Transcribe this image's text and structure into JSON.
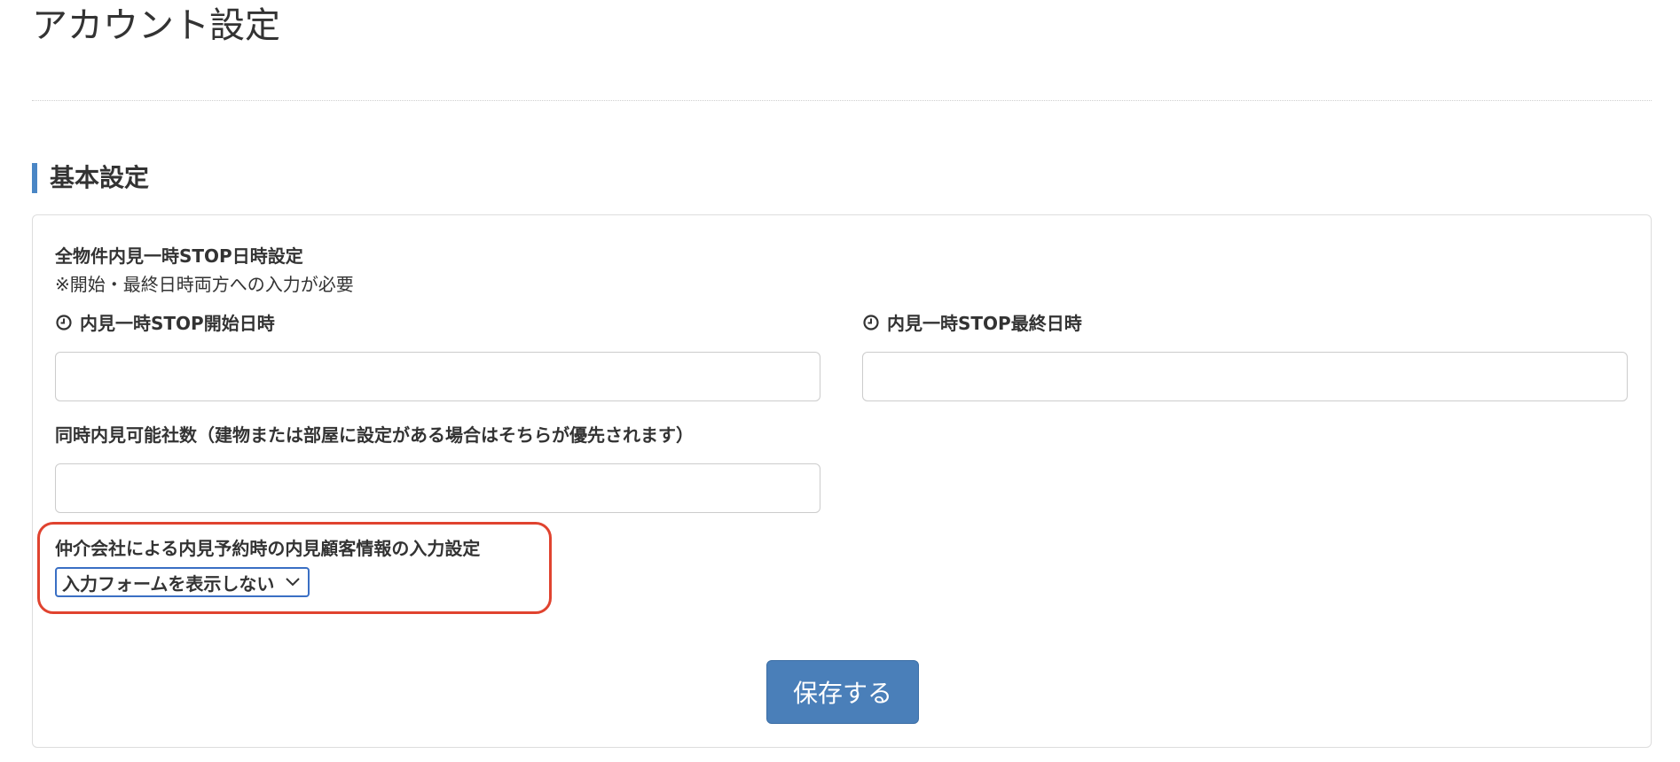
{
  "page": {
    "title": "アカウント設定"
  },
  "section": {
    "heading": "基本設定"
  },
  "form": {
    "stop_title": "全物件内見一時STOP日時設定",
    "stop_note": "※開始・最終日時両方への入力が必要",
    "start_label": "内見一時STOP開始日時",
    "start_value": "",
    "end_label": "内見一時STOP最終日時",
    "end_value": "",
    "concurrent_label": "同時内見可能社数（建物または部屋に設定がある場合はそちらが優先されます）",
    "concurrent_value": "",
    "customer_info_label": "仲介会社による内見予約時の内見顧客情報の入力設定",
    "customer_info_selected": "入力フォームを表示しない",
    "save_label": "保存する"
  },
  "icons": {
    "field_icon": "clock-icon",
    "select_icon": "chevron-down-icon"
  },
  "colors": {
    "accent": "#4a86c5",
    "button": "#4a7fb9",
    "highlight": "#e0432f",
    "select_border": "#3a6fc4"
  }
}
